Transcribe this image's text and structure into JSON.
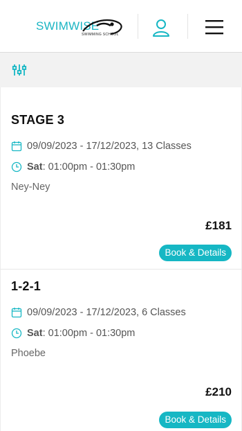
{
  "brand": {
    "name": "SWIMWISE",
    "tagline": "SWIMMING SCHOOL",
    "accent": "#16b7c4"
  },
  "header": {
    "user_icon": "user-icon",
    "menu_icon": "hamburger-menu-icon"
  },
  "filters": {
    "icon": "sliders-icon"
  },
  "classes": [
    {
      "title": "STAGE 3",
      "dates": "09/09/2023 - 17/12/2023, 13 Classes",
      "day": "Sat",
      "time": ": 01:00pm - 01:30pm",
      "teacher": "Ney-Ney",
      "price": "£181",
      "button": "Book & Details"
    },
    {
      "title": "1-2-1",
      "dates": "09/09/2023 - 17/12/2023, 6 Classes",
      "day": "Sat",
      "time": ": 01:00pm - 01:30pm",
      "teacher": "Phoebe",
      "price": "£210",
      "button": "Book & Details"
    }
  ]
}
